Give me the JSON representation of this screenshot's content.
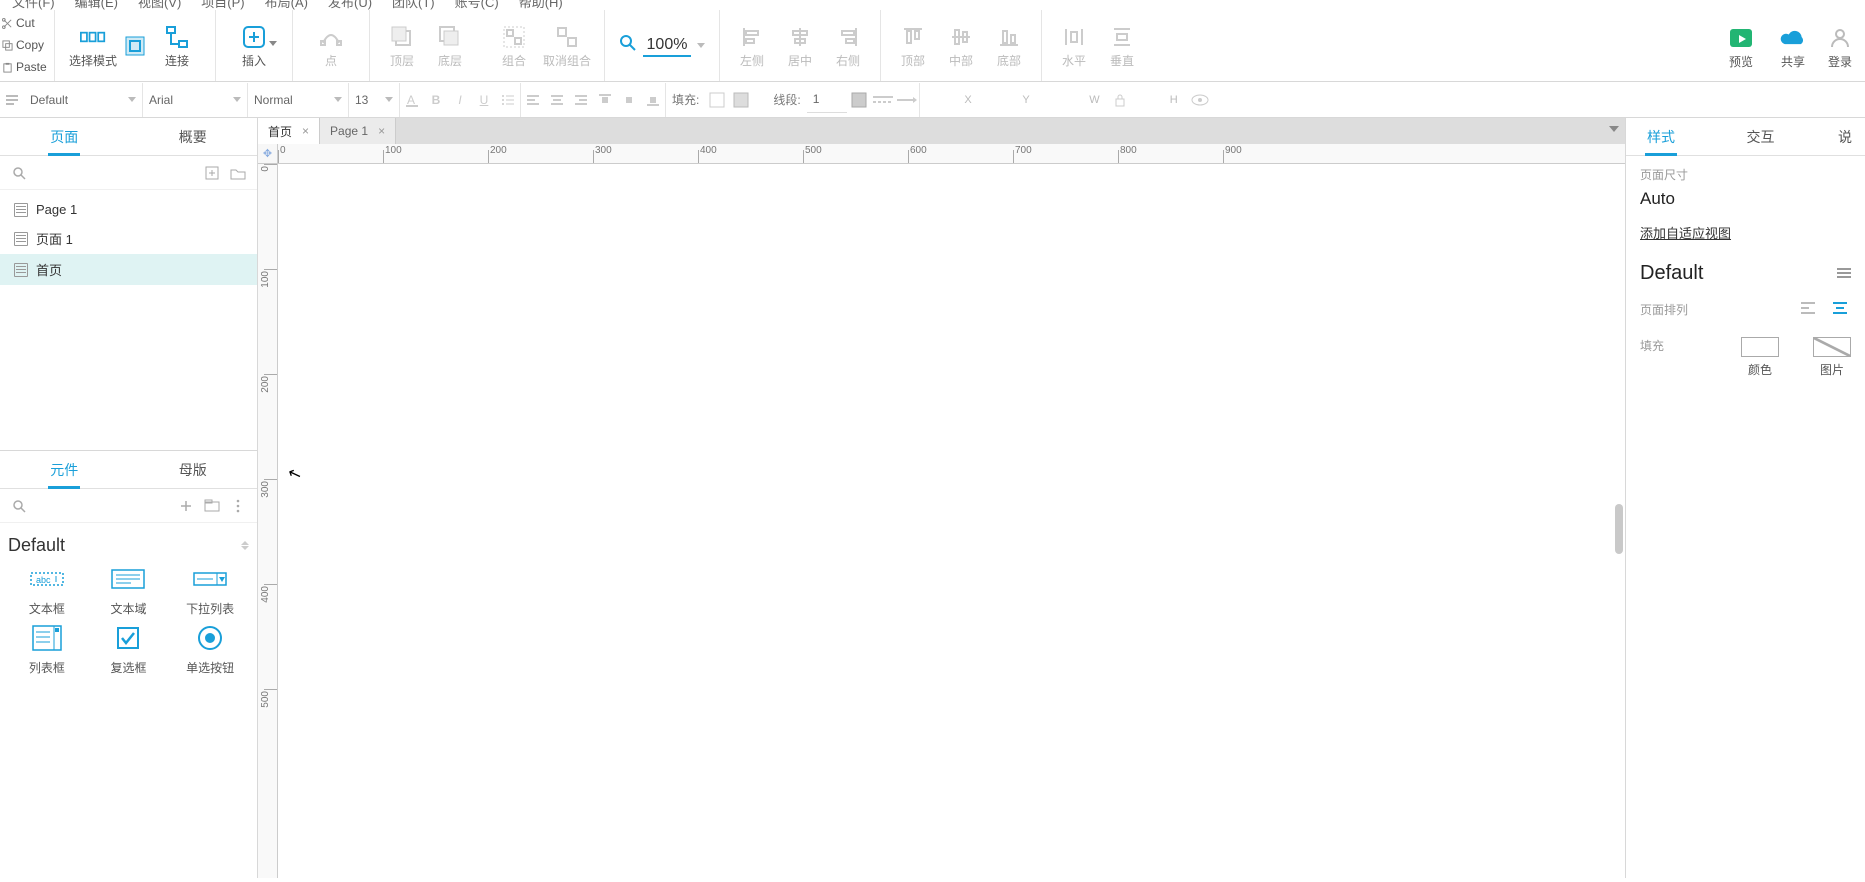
{
  "menubar": {
    "file": "文件(F)",
    "edit": "编辑(E)",
    "view": "视图(V)",
    "project": "项目(P)",
    "arrange": "布局(A)",
    "publish": "发布(U)",
    "team": "团队(T)",
    "account": "账号(C)",
    "help": "帮助(H)"
  },
  "clip": {
    "cut": "Cut",
    "copy": "Copy",
    "paste": "Paste"
  },
  "ribbon": {
    "select_mode": "选择模式",
    "connect": "连接",
    "insert": "插入",
    "point": "点",
    "front": "顶层",
    "back": "底层",
    "group": "组合",
    "ungroup": "取消组合",
    "zoom_value": "100%",
    "align_left": "左侧",
    "align_center": "居中",
    "align_right": "右侧",
    "align_top": "顶部",
    "align_middle": "中部",
    "align_bottom": "底部",
    "dist_h": "水平",
    "dist_v": "垂直",
    "preview": "预览",
    "share": "共享",
    "login": "登录"
  },
  "propbar": {
    "style_default": "Default",
    "font": "Arial",
    "weight": "Normal",
    "size": "13",
    "fill_label": "填充:",
    "line_label": "线段:",
    "line_width": "1",
    "coord_x": "X",
    "coord_y": "Y",
    "coord_w": "W",
    "coord_h": "H"
  },
  "left": {
    "tab_pages": "页面",
    "tab_outline": "概要",
    "pages": [
      "Page 1",
      "页面 1",
      "首页"
    ],
    "active_page_index": 2,
    "tab_widgets": "元件",
    "tab_masters": "母版",
    "library_header": "Default",
    "widgets": [
      {
        "id": "textfield",
        "label": "文本框"
      },
      {
        "id": "textarea",
        "label": "文本域"
      },
      {
        "id": "dropdown",
        "label": "下拉列表"
      },
      {
        "id": "listbox",
        "label": "列表框"
      },
      {
        "id": "checkbox",
        "label": "复选框"
      },
      {
        "id": "radio",
        "label": "单选按钮"
      }
    ]
  },
  "doc_tabs": {
    "t0": "首页",
    "t1": "Page 1"
  },
  "ruler_h": [
    "0",
    "100",
    "200",
    "300",
    "400",
    "500",
    "600",
    "700",
    "800",
    "900"
  ],
  "ruler_v": [
    "0",
    "100",
    "200",
    "300",
    "400",
    "500"
  ],
  "right": {
    "tab_style": "样式",
    "tab_interact": "交互",
    "tab_notes": "说",
    "page_size_label": "页面尺寸",
    "page_size_value": "Auto",
    "add_adaptive": "添加自适应视图",
    "default_header": "Default",
    "page_align_label": "页面排列",
    "fill_label": "填充",
    "fill_color": "颜色",
    "fill_image": "图片"
  },
  "colors": {
    "accent": "#199fd9"
  }
}
